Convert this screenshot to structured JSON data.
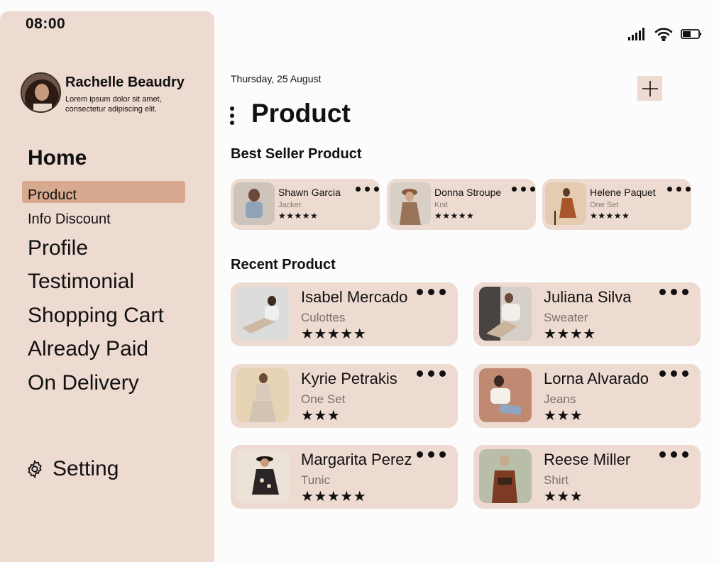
{
  "status_bar": {
    "time": "08:00",
    "icons": [
      "signal-icon",
      "wifi-icon",
      "battery-icon"
    ]
  },
  "profile": {
    "name": "Rachelle Beaudry",
    "description": "Lorem ipsum dolor sit amet, consectetur adipiscing elit."
  },
  "nav": {
    "home": "Home",
    "product": "Product",
    "info_discount": "Info Discount",
    "profile": "Profile",
    "testimonial": "Testimonial",
    "shopping_cart": "Shopping Cart",
    "already_paid": "Already Paid",
    "on_delivery": "On Delivery",
    "setting": "Setting",
    "active_item": "Product"
  },
  "main": {
    "date": "Thursday, 25 August",
    "title": "Product",
    "best_seller_heading": "Best Seller Product",
    "recent_heading": "Recent Product"
  },
  "best_sellers": [
    {
      "name": "Shawn Garcia",
      "category": "Jacket",
      "stars": "★★★★★"
    },
    {
      "name": "Donna Stroupe",
      "category": "Knit",
      "stars": "★★★★★"
    },
    {
      "name": "Helene Paquet",
      "category": "One Set",
      "stars": "★★★★★"
    }
  ],
  "recent": [
    {
      "name": "Isabel Mercado",
      "category": "Culottes",
      "stars": "★★★★★"
    },
    {
      "name": "Juliana Silva",
      "category": "Sweater",
      "stars": "★★★★"
    },
    {
      "name": "Kyrie Petrakis",
      "category": "One Set",
      "stars": "★★★"
    },
    {
      "name": "Lorna Alvarado",
      "category": "Jeans",
      "stars": "★★★"
    },
    {
      "name": "Margarita Perez",
      "category": "Tunic",
      "stars": "★★★★★"
    },
    {
      "name": "Reese Miller",
      "category": "Shirt",
      "stars": "★★★"
    }
  ],
  "colors": {
    "sidebar": "#eddad0",
    "active": "#d7a98e",
    "card": "#eddad0",
    "background": "#fdfcfc"
  }
}
